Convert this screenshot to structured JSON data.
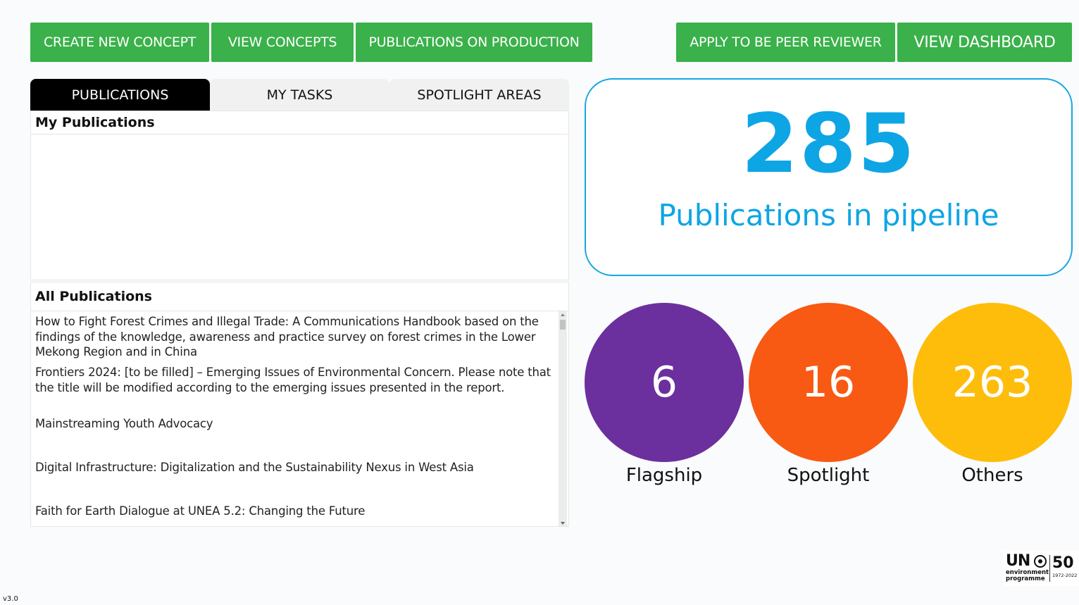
{
  "toolbar": {
    "create_new_concept": "CREATE NEW CONCEPT",
    "view_concepts": "VIEW CONCEPTS",
    "publications_on_production": "PUBLICATIONS ON PRODUCTION",
    "apply_peer_reviewer": "APPLY TO BE PEER REVIEWER",
    "view_dashboard": "VIEW DASHBOARD"
  },
  "tabs": [
    {
      "label": "PUBLICATIONS",
      "active": true
    },
    {
      "label": "MY TASKS",
      "active": false
    },
    {
      "label": "SPOTLIGHT AREAS",
      "active": false
    }
  ],
  "my_publications": {
    "title": "My Publications",
    "items": []
  },
  "all_publications": {
    "title": "All Publications",
    "items": [
      "How to Fight Forest Crimes and Illegal Trade: A Communications Handbook based on the findings of the knowledge, awareness and practice survey on forest crimes in the Lower Mekong Region and in China",
      "Frontiers 2024: [to be filled] – Emerging Issues of Environmental Concern.  Please note that the title will be modified according to the emerging issues presented in the report.",
      "Mainstreaming Youth Advocacy",
      "Digital Infrastructure: Digitalization and the Sustainability Nexus in West Asia",
      "Faith for Earth Dialogue at UNEA 5.2: Changing the Future"
    ]
  },
  "pipeline": {
    "count": "285",
    "label": "Publications in pipeline",
    "accent": "#0ea5e4"
  },
  "categories": [
    {
      "value": "6",
      "label": "Flagship",
      "color": "#6c2f9e"
    },
    {
      "value": "16",
      "label": "Spotlight",
      "color": "#f85a13"
    },
    {
      "value": "263",
      "label": "Others",
      "color": "#fdbd0a"
    }
  ],
  "logo": {
    "un": "UN",
    "environment": "environment",
    "programme": "programme",
    "anniversary": "50",
    "years": "1972-2022"
  },
  "version": "v3.0",
  "colors": {
    "button_green": "#3ab14a",
    "active_tab": "#000000"
  }
}
